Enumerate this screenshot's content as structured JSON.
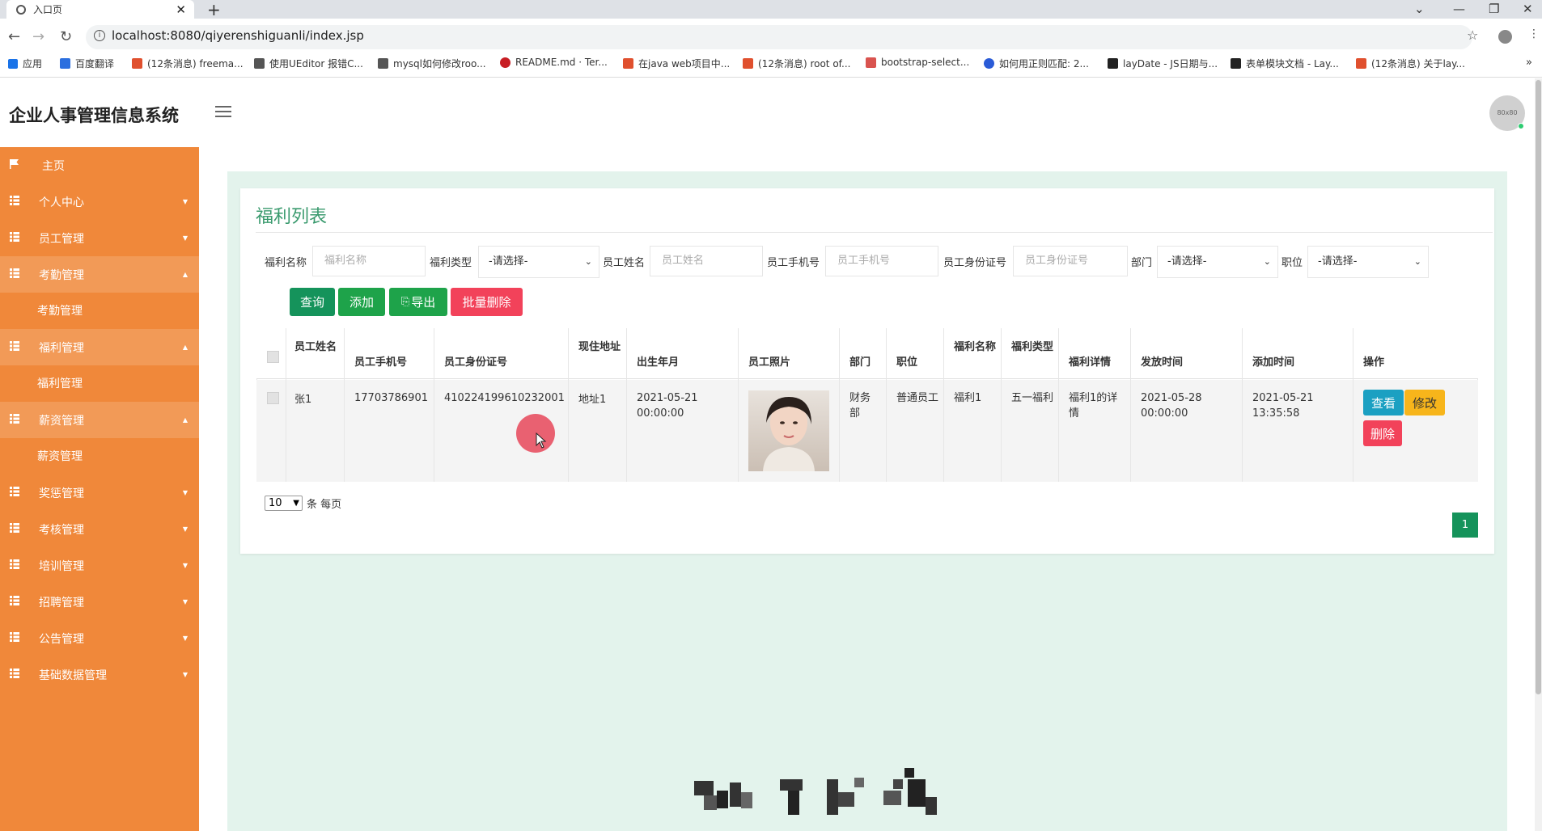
{
  "browser": {
    "tab_title": "入口页",
    "url": "localhost:8080/qiyerenshiguanli/index.jsp",
    "bookmarks": [
      "应用",
      "百度翻译",
      "(12条消息) freema...",
      "使用UEditor 报错C...",
      "mysql如何修改roo...",
      "README.md · Ter...",
      "在java web项目中...",
      "(12条消息) root of...",
      "bootstrap-select...",
      "如何用正则匹配: 2...",
      "layDate - JS日期与...",
      "表单模块文档 - Lay...",
      "(12条消息) 关于lay..."
    ]
  },
  "app": {
    "title": "企业人事管理信息系统",
    "avatar_text": "80x80"
  },
  "sidebar": {
    "items": [
      {
        "label": "主页"
      },
      {
        "label": "个人中心"
      },
      {
        "label": "员工管理"
      },
      {
        "label": "考勤管理"
      },
      {
        "label": "考勤管理"
      },
      {
        "label": "福利管理"
      },
      {
        "label": "福利管理"
      },
      {
        "label": "薪资管理"
      },
      {
        "label": "薪资管理"
      },
      {
        "label": "奖惩管理"
      },
      {
        "label": "考核管理"
      },
      {
        "label": "培训管理"
      },
      {
        "label": "招聘管理"
      },
      {
        "label": "公告管理"
      },
      {
        "label": "基础数据管理"
      }
    ]
  },
  "panel": {
    "title": "福利列表",
    "filters": {
      "welfare_name_label": "福利名称",
      "welfare_name_placeholder": "福利名称",
      "welfare_type_label": "福利类型",
      "welfare_type_value": "-请选择-",
      "emp_name_label": "员工姓名",
      "emp_name_placeholder": "员工姓名",
      "emp_phone_label": "员工手机号",
      "emp_phone_placeholder": "员工手机号",
      "emp_id_label": "员工身份证号",
      "emp_id_placeholder": "员工身份证号",
      "dept_label": "部门",
      "dept_value": "-请选择-",
      "position_label": "职位",
      "position_value": "-请选择-"
    },
    "buttons": {
      "query": "查询",
      "add": "添加",
      "export": "导出",
      "batch_delete": "批量删除"
    },
    "table": {
      "headers": [
        "员工姓名",
        "员工手机号",
        "员工身份证号",
        "现住地址",
        "出生年月",
        "员工照片",
        "部门",
        "职位",
        "福利名称",
        "福利类型",
        "福利详情",
        "发放时间",
        "添加时间",
        "操作"
      ],
      "rows": [
        {
          "name": "张1",
          "phone": "17703786901",
          "id_card": "410224199610232001",
          "address": "地址1",
          "birth": "2021-05-21 00:00:00",
          "dept": "财务部",
          "position": "普通员工",
          "welfare_name": "福利1",
          "welfare_type": "五一福利",
          "welfare_detail": "福利1的详情",
          "issue_time": "2021-05-28 00:00:00",
          "add_time": "2021-05-21 13:35:58",
          "actions": {
            "view": "查看",
            "edit": "修改",
            "delete": "删除"
          }
        }
      ]
    },
    "pagination": {
      "page_size": "10",
      "per_page_text": "条 每页",
      "current_page": "1"
    }
  }
}
